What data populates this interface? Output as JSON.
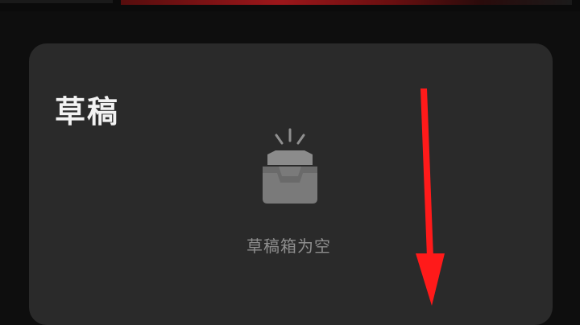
{
  "drafts_panel": {
    "title": "草稿",
    "empty_state": {
      "icon": "inbox-empty-icon",
      "message": "草稿箱为空"
    }
  },
  "annotation": {
    "icon": "red-down-arrow",
    "color": "#ff1a1a"
  },
  "colors": {
    "background": "#0e0e0e",
    "card": "#2a2a2a",
    "title": "#f2f2f2",
    "muted": "#8e8e8e",
    "top_accent": "#a3171b"
  }
}
